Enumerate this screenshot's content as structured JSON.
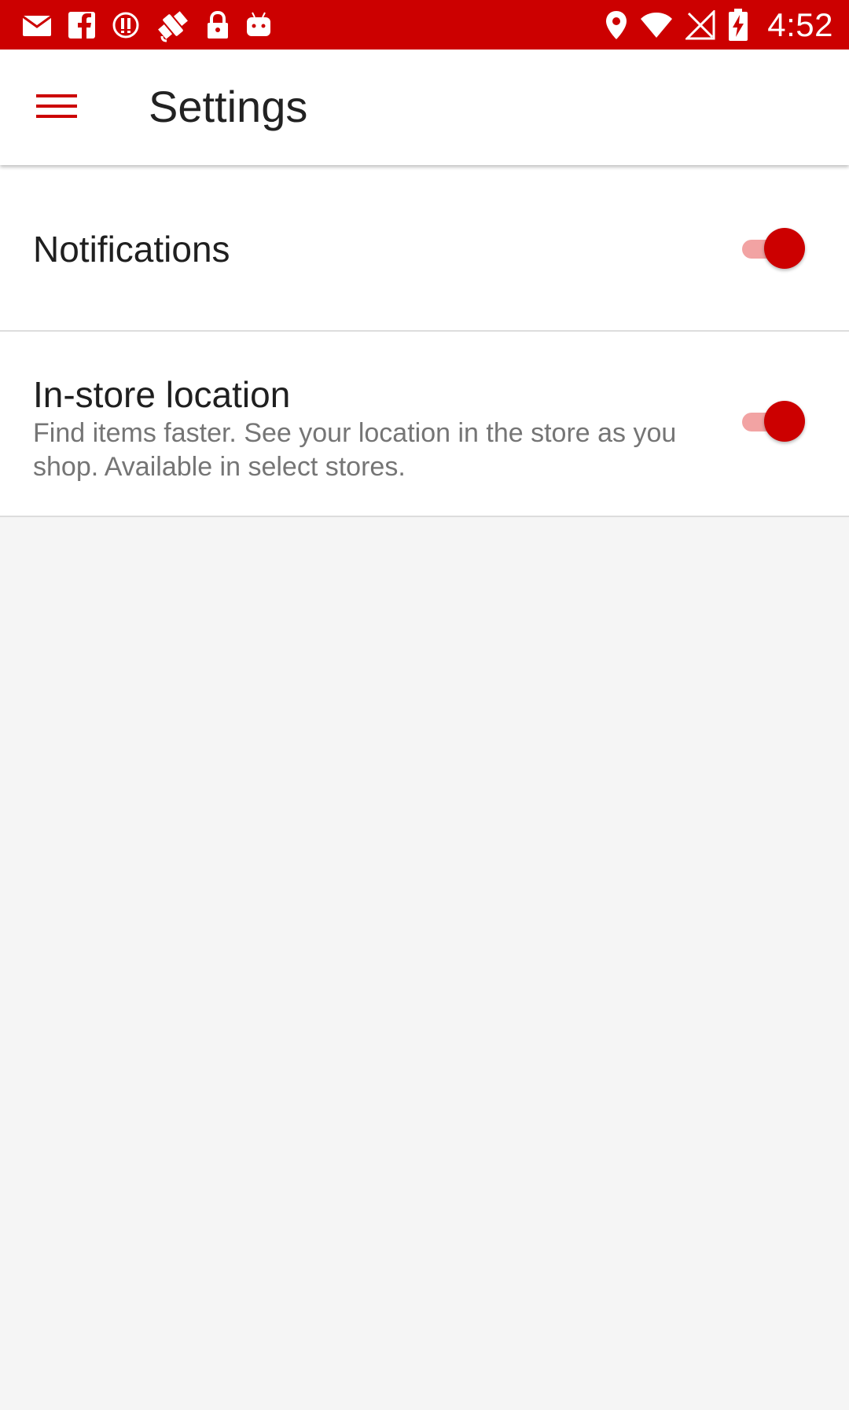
{
  "status_bar": {
    "time": "4:52",
    "left_icons": [
      "mail-icon",
      "facebook-icon",
      "alert-icon",
      "fake-gps-icon",
      "lock-icon",
      "android-icon"
    ],
    "right_icons": [
      "location-icon",
      "wifi-icon",
      "no-signal-icon",
      "battery-charging-icon"
    ],
    "color": "#cc0000"
  },
  "app_bar": {
    "title": "Settings",
    "menu_icon": "hamburger-menu-icon",
    "accent": "#cc0000"
  },
  "settings": {
    "notifications": {
      "title": "Notifications",
      "enabled": true
    },
    "in_store_location": {
      "title": "In-store location",
      "description": "Find items faster. See your location in the store as you shop. Available in select stores.",
      "enabled": true
    }
  },
  "colors": {
    "toggle_thumb": "#cc0000",
    "toggle_track": "#f2a3a3",
    "background": "#f5f5f5"
  }
}
